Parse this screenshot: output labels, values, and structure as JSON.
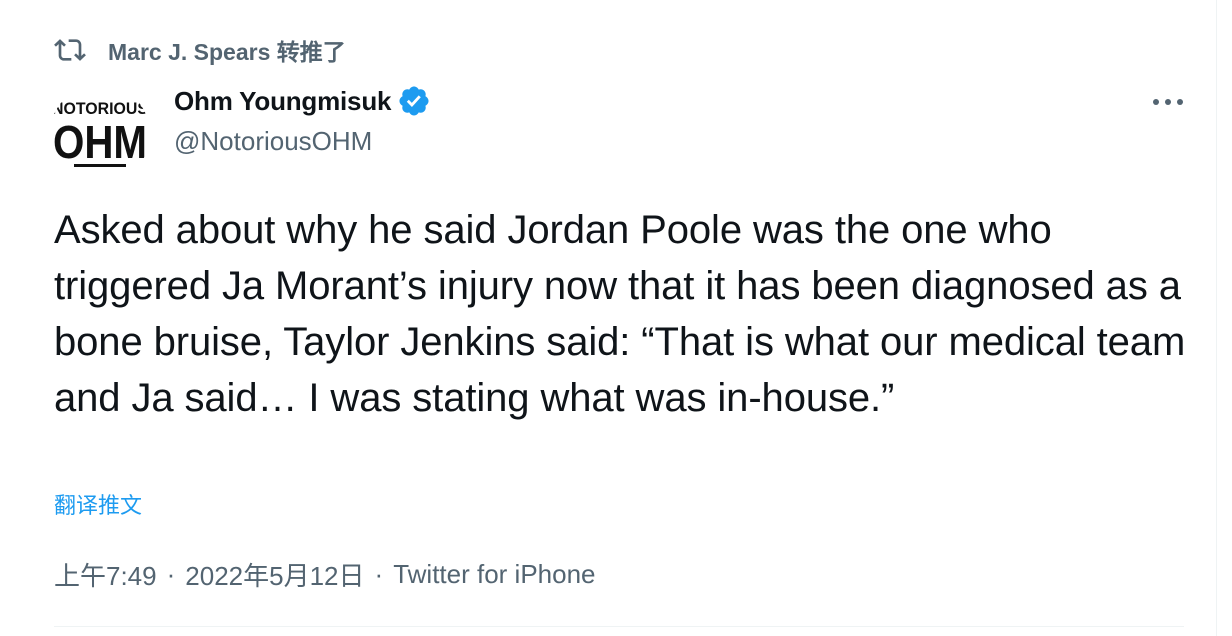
{
  "retweet": {
    "icon": "retweet-icon",
    "label": "Marc J. Spears 转推了"
  },
  "author": {
    "avatar_text_top": "NOTORIOUS",
    "avatar_text_bottom": "OHM",
    "display_name": "Ohm Youngmisuk",
    "verified": true,
    "verified_icon": "verified-badge-icon",
    "handle": "@NotoriousOHM"
  },
  "more_icon": "more-options-icon",
  "tweet": {
    "text": "Asked about why he said Jordan Poole was the one who triggered Ja Morant’s injury now that it has been diagnosed as a bone bruise, Taylor Jenkins said: “That is what our medical team and Ja said… I was stating what was in-house.”",
    "translate_label": "翻译推文"
  },
  "meta": {
    "time": "上午7:49",
    "date": "2022年5月12日",
    "separator": "·",
    "source": "Twitter for iPhone"
  },
  "colors": {
    "text_primary": "#0f1419",
    "text_secondary": "#536471",
    "accent": "#1d9bf0",
    "divider": "#eff3f4"
  }
}
